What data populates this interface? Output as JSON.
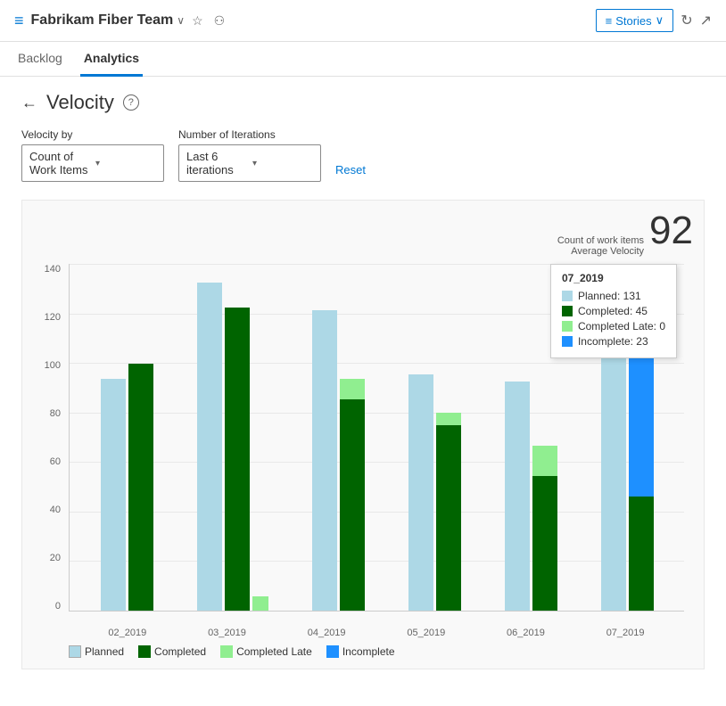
{
  "header": {
    "icon": "≡",
    "teamName": "Fabrikam Fiber Team",
    "chevron": "∨",
    "starIcon": "☆",
    "peopleIcon": "👥",
    "storiesLabel": "Stories",
    "storiesChevron": "∨",
    "refreshIcon": "↻",
    "expandIcon": "↗"
  },
  "nav": {
    "tabs": [
      {
        "label": "Backlog",
        "active": false
      },
      {
        "label": "Analytics",
        "active": true
      }
    ]
  },
  "page": {
    "backArrow": "←",
    "title": "Velocity",
    "helpIcon": "?",
    "velocityByLabel": "Velocity by",
    "velocityByValue": "Count of Work Items",
    "iterationsLabel": "Number of Iterations",
    "iterationsValue": "Last 6 iterations",
    "resetLabel": "Reset"
  },
  "chart": {
    "avgVelocityLabel": "Count of work items",
    "avgVelocitySubLabel": "Average Velocity",
    "avgVelocityValue": "92",
    "yAxisLabels": [
      "140",
      "120",
      "100",
      "80",
      "60",
      "40",
      "20",
      "0"
    ],
    "bars": [
      {
        "label": "02_2019",
        "planned": 91,
        "completed": 97,
        "completedLate": 0,
        "incomplete": 0
      },
      {
        "label": "03_2019",
        "planned": 129,
        "completed": 119,
        "completedLate": 0,
        "incomplete": 0
      },
      {
        "label": "04_2019",
        "planned": 118,
        "completed": 83,
        "completedLate": 8,
        "incomplete": 0
      },
      {
        "label": "05_2019",
        "planned": 93,
        "completed": 73,
        "completedLate": 5,
        "incomplete": 0
      },
      {
        "label": "06_2019",
        "planned": 90,
        "completed": 53,
        "completedLate": 12,
        "incomplete": 0
      },
      {
        "label": "07_2019",
        "planned": 131,
        "completed": 45,
        "completedLate": 0,
        "incomplete": 23
      }
    ],
    "tooltip": {
      "title": "07_2019",
      "rows": [
        {
          "color": "#add8e6",
          "label": "Planned:",
          "value": "131"
        },
        {
          "color": "#006400",
          "label": "Completed:",
          "value": "45"
        },
        {
          "color": "#90ee90",
          "label": "Completed Late:",
          "value": "0"
        },
        {
          "color": "#1e90ff",
          "label": "Incomplete:",
          "value": "23"
        }
      ]
    },
    "legend": [
      {
        "color": "#add8e6",
        "label": "Planned"
      },
      {
        "color": "#006400",
        "label": "Completed"
      },
      {
        "color": "#90ee90",
        "label": "Completed Late"
      },
      {
        "color": "#1e90ff",
        "label": "Incomplete"
      }
    ]
  }
}
